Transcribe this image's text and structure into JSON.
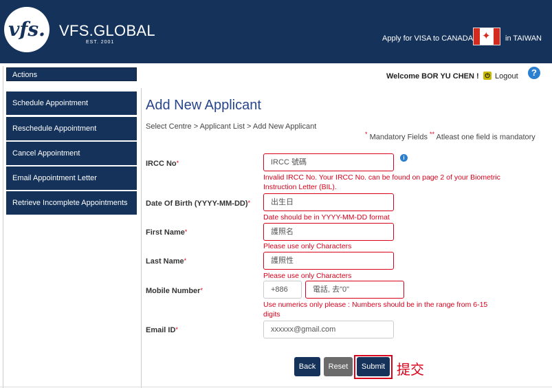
{
  "header": {
    "logo_text": "vfs.",
    "brand": "VFS.GLOBAL",
    "est": "EST. 2001",
    "apply_text": "Apply for VISA to CANADA",
    "location_text": "in TAIWAN"
  },
  "sidebar": {
    "title": "Actions",
    "items": [
      {
        "label": "Schedule Appointment"
      },
      {
        "label": "Reschedule Appointment"
      },
      {
        "label": "Cancel Appointment"
      },
      {
        "label": "Email Appointment Letter"
      },
      {
        "label": "Retrieve Incomplete Appointments"
      }
    ]
  },
  "topbar": {
    "welcome": "Welcome BOR YU CHEN !",
    "logout": "Logout",
    "help": "?"
  },
  "page": {
    "title": "Add New Applicant",
    "breadcrumb": "Select Centre  >  Applicant List  >  Add New Applicant",
    "mandatory_fields": "Mandatory Fields",
    "atleast_one": "Atleast one field is mandatory"
  },
  "form": {
    "ircc": {
      "label": "IRCC No",
      "value": "IRCC 號碼",
      "error": "Invalid IRCC No. Your IRCC No. can be found on page 2 of your Biometric Instruction Letter (BIL)."
    },
    "dob": {
      "label": "Date Of Birth (YYYY-MM-DD)",
      "value": "出生日",
      "error": "Date should be in YYYY-MM-DD format"
    },
    "first_name": {
      "label": "First Name",
      "value": "護照名",
      "error": "Please use only Characters"
    },
    "last_name": {
      "label": "Last Name",
      "value": "護照性",
      "error": "Please use only Characters"
    },
    "mobile": {
      "label": "Mobile Number",
      "code": "+886",
      "value": "電話, 去\"0\"",
      "error": "Use numerics only please : Numbers should be in the range from 6-15 digits"
    },
    "email": {
      "label": "Email ID",
      "value": "xxxxxx@gmail.com"
    }
  },
  "buttons": {
    "back": "Back",
    "reset": "Reset",
    "submit": "Submit"
  },
  "annotation": {
    "submit_note": "提交"
  },
  "colors": {
    "navy": "#14325a",
    "error_red": "#d9001b",
    "title_blue": "#26458c"
  }
}
